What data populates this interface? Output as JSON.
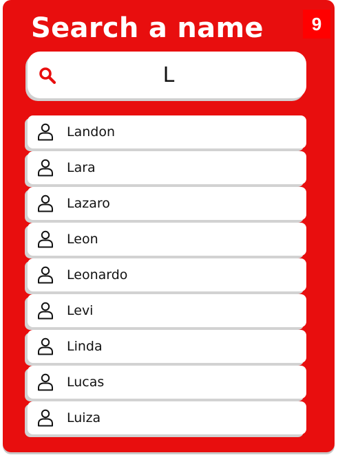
{
  "header": {
    "title": "Search a name",
    "result_count": "9"
  },
  "search": {
    "value": "L",
    "icon": "search-icon",
    "accent_color": "#e80e0e"
  },
  "results": [
    {
      "name": "Landon",
      "icon": "user-icon"
    },
    {
      "name": "Lara",
      "icon": "user-icon"
    },
    {
      "name": "Lazaro",
      "icon": "user-icon"
    },
    {
      "name": "Leon",
      "icon": "user-icon"
    },
    {
      "name": "Leonardo",
      "icon": "user-icon"
    },
    {
      "name": "Levi",
      "icon": "user-icon"
    },
    {
      "name": "Linda",
      "icon": "user-icon"
    },
    {
      "name": "Lucas",
      "icon": "user-icon"
    },
    {
      "name": "Luiza",
      "icon": "user-icon"
    }
  ]
}
